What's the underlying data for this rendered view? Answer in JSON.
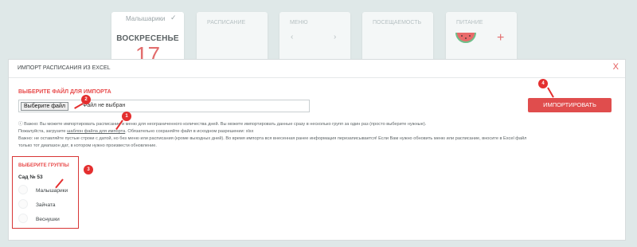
{
  "cards": [
    {
      "group": "Малышарики",
      "day": "ВОСКРЕСЕНЬЕ",
      "date_number": "17"
    },
    {
      "label": "РАСПИСАНИЕ"
    },
    {
      "label": "МЕНЮ",
      "prev": "‹",
      "next": "›"
    },
    {
      "label": "ПОСЕЩАЕМОСТЬ"
    },
    {
      "label": "ПИТАНИЕ",
      "plus": "+"
    }
  ],
  "modal": {
    "title": "ИМПОРТ РАСПИСАНИЯ ИЗ EXCEL",
    "close": "X",
    "file_section_label": "ВЫБЕРИТЕ ФАЙЛ ДЛЯ ИМПОРТА",
    "file_button": "Выберите файл",
    "file_status": "Файл не выбран",
    "import_button": "ИМПОРТИРОВАТЬ",
    "note_line1": "ⓘ Важно: Вы можете импортировать расписание и меню для неограниченного количества дней. Вы можете импортировать данные сразу в несколько групп за один раз (просто выберите нужные).",
    "note_line2_pre": "Пожалуйста, загрузите ",
    "note_line2_link": "шаблон файла для импорта",
    "note_line2_post": ". Обязательно сохраняйте файл в исходном разрешении: xlsx",
    "note_line3": "Важно: не оставляйте пустые строки с датой, но без меню или расписания (кроме выходных дней). Во время импорта вся внесенная ранее информация перезаписывается! Если Вам нужно обновить меню или расписание, вносите в Excel файл",
    "note_line4": "только тот диапазон дат, в котором нужно произвести обновление.",
    "groups_label": "ВЫБЕРИТЕ ГРУППЫ",
    "organization": "Сад № 53",
    "groups": [
      "Малышарики",
      "Зайчата",
      "Веснушки"
    ]
  },
  "badges": [
    "1",
    "2",
    "3",
    "4"
  ],
  "colors": {
    "accent": "#e04d4d",
    "badge": "#e42f2f"
  }
}
